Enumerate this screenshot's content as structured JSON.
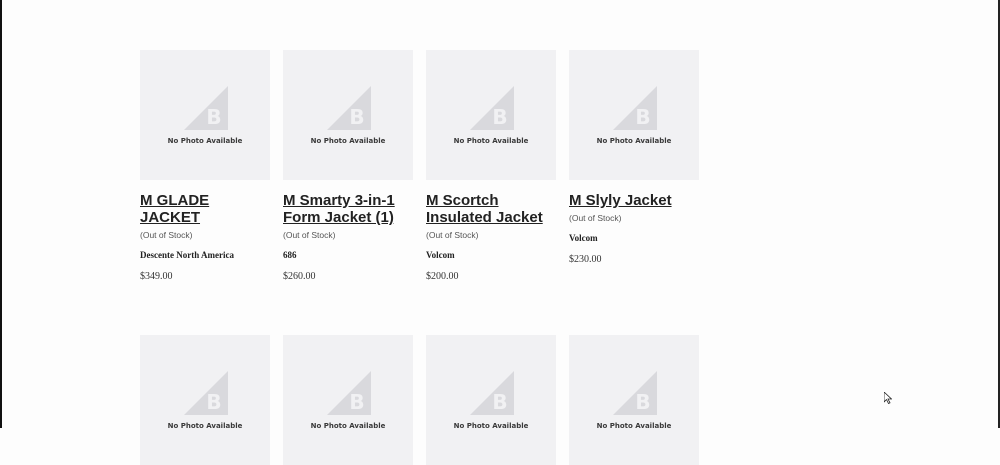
{
  "no_photo_text": "No Photo Available",
  "products": [
    {
      "name": "M GLADE JACKET",
      "stock": "(Out of Stock)",
      "brand": "Descente North America",
      "price": "$349.00"
    },
    {
      "name": "M Smarty 3-in-1 Form Jacket (1)",
      "stock": "(Out of Stock)",
      "brand": "686",
      "price": "$260.00"
    },
    {
      "name": "M Scortch Insulated Jacket",
      "stock": "(Out of Stock)",
      "brand": "Volcom",
      "price": "$200.00"
    },
    {
      "name": "M Slyly Jacket",
      "stock": "(Out of Stock)",
      "brand": "Volcom",
      "price": "$230.00"
    }
  ],
  "icons": {
    "placeholder": "bigcommerce-b-logo-icon",
    "cursor": "mouse-pointer-icon"
  }
}
